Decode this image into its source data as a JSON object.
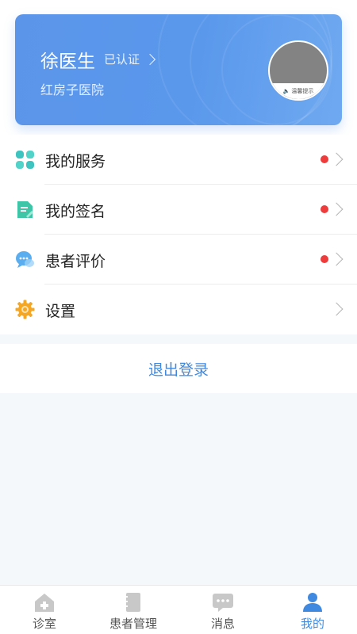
{
  "profile": {
    "name": "徐医生",
    "verified_label": "已认证",
    "hospital": "红房子医院",
    "avatar_caption": "温馨提示"
  },
  "menu": {
    "items": [
      {
        "label": "我的服务",
        "icon": "clover-icon",
        "has_dot": true
      },
      {
        "label": "我的签名",
        "icon": "signature-doc-icon",
        "has_dot": true
      },
      {
        "label": "患者评价",
        "icon": "chat-bubble-icon",
        "has_dot": true
      },
      {
        "label": "设置",
        "icon": "gear-icon",
        "has_dot": false
      }
    ]
  },
  "logout": {
    "label": "退出登录"
  },
  "tabbar": {
    "tabs": [
      {
        "label": "诊室",
        "icon": "clinic-house-icon",
        "active": false
      },
      {
        "label": "患者管理",
        "icon": "notebook-icon",
        "active": false
      },
      {
        "label": "消息",
        "icon": "message-icon",
        "active": false
      },
      {
        "label": "我的",
        "icon": "person-icon",
        "active": true
      }
    ]
  },
  "colors": {
    "brand_blue": "#5a98ec",
    "accent_text": "#3f8ae0",
    "badge_red": "#ee3b3b",
    "inactive_icon": "#c8c8c8"
  }
}
